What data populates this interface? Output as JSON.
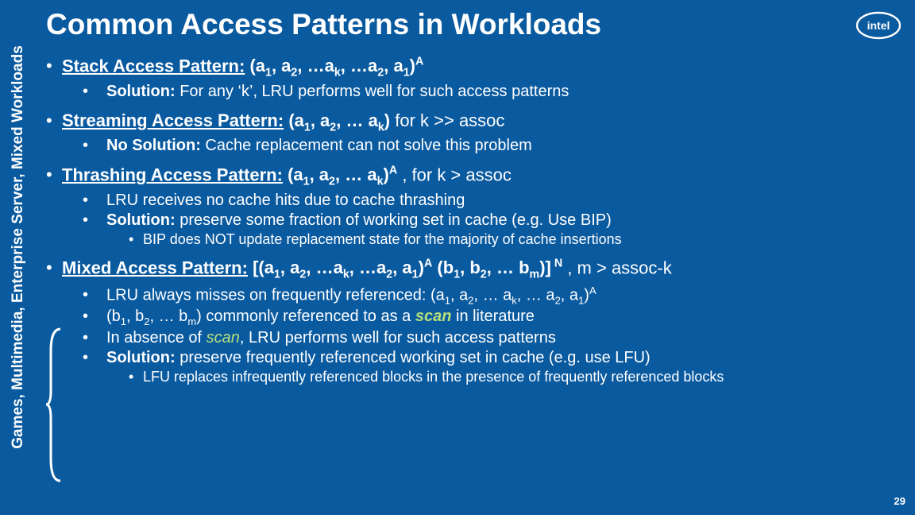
{
  "side_label": "Games, Multimedia, Enterprise Server, Mixed Workloads",
  "title": "Common Access Patterns in Workloads",
  "page_number": "29",
  "logo_text": "intel",
  "pat1": {
    "label": "Stack Access Pattern:",
    "seq_pre": "(a",
    "s1": "1",
    "c1": ",  a",
    "s2": "2",
    "c2": ", …a",
    "s3": "k",
    "c3": ", …a",
    "s4": "2",
    "c4": ",  a",
    "s5": "1",
    "c5": ")",
    "sup": "A",
    "sub1_b": "Solution:",
    "sub1": " For any ‘k’, LRU performs well for such access patterns"
  },
  "pat2": {
    "label": "Streaming Access Pattern:",
    "seq_pre": "(a",
    "s1": "1",
    "c1": ",  a",
    "s2": "2",
    "c2": ", … a",
    "s3": "k",
    "c3": ")",
    "tail": " for k >> assoc",
    "sub1_b": "No Solution:",
    "sub1": " Cache replacement can not solve this problem"
  },
  "pat3": {
    "label": "Thrashing Access Pattern:",
    "seq_pre": "(a",
    "s1": "1",
    "c1": ",  a",
    "s2": "2",
    "c2": ", … a",
    "s3": "k",
    "c3": ")",
    "sup": "A",
    "tail": " , for k > assoc",
    "sub1": "LRU receives no cache hits due to cache thrashing",
    "sub2_b": "Solution:",
    "sub2": " preserve some fraction of working set in cache (e.g. Use BIP)",
    "subsub": "BIP does NOT update replacement state for the majority of cache insertions"
  },
  "pat4": {
    "label": "Mixed Access Pattern:",
    "lb": "[(a",
    "s1": "1",
    "c1": ",  a",
    "s2": "2",
    "c2": ", …a",
    "s3": "k",
    "c3": ", …a",
    "s4": "2",
    "c4": ",  a",
    "s5": "1",
    "c5": ")",
    "supA": "A",
    "mid": " (b",
    "bs1": "1",
    "bc1": ",  b",
    "bs2": "2",
    "bc2": ", … b",
    "bs3": "m",
    "bc3": ")]",
    "supN": " N",
    "tail": ", m > assoc-k",
    "sub1a": "LRU always misses on frequently referenced: (a",
    "sub1_s1": "1",
    "sub1_c1": ", a",
    "sub1_s2": "2",
    "sub1_c2": ", … a",
    "sub1_s3": "k",
    "sub1_c3": ", … a",
    "sub1_s4": "2",
    "sub1_c4": ", a",
    "sub1_s5": "1",
    "sub1_c5": ")",
    "sub1_sup": "A",
    "sub2a": "(b",
    "sub2_s1": "1",
    "sub2_c1": ", b",
    "sub2_s2": "2",
    "sub2_c2": ", … b",
    "sub2_s3": "m",
    "sub2_c3": ") commonly referenced to as a ",
    "sub2_scan": "scan",
    "sub2_tail": " in literature",
    "sub3a": "In absence of ",
    "sub3_scan": "scan",
    "sub3b": ", LRU performs well for such access patterns",
    "sub4_b": "Solution:",
    "sub4": "  preserve frequently referenced working set in cache (e.g. use LFU)",
    "subsub": "LFU replaces infrequently referenced blocks in the presence of frequently referenced blocks"
  }
}
